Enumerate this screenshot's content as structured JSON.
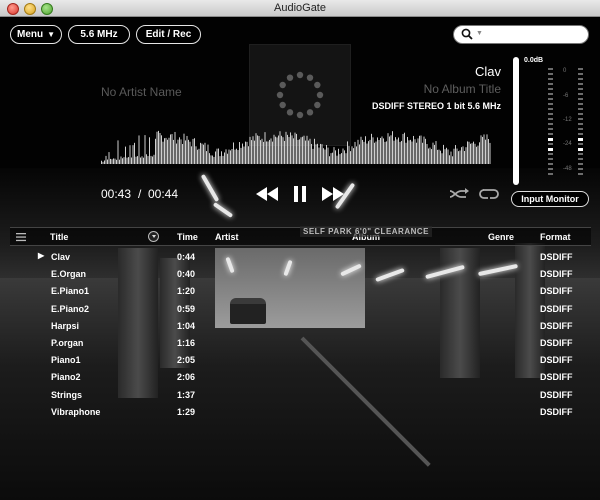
{
  "window": {
    "title": "AudioGate"
  },
  "toolbar": {
    "menu_label": "Menu",
    "frequency_label": "5.6 MHz",
    "edit_label": "Edit / Rec"
  },
  "search": {
    "placeholder": ""
  },
  "now_playing": {
    "artist": "No Artist Name",
    "track": "Clav",
    "album": "No Album Title",
    "format_info": "DSDIFF STEREO 1 bit 5.6 MHz"
  },
  "meter": {
    "peak_label": "0.0dB",
    "ticks": [
      "0",
      "-6",
      "-12",
      "-24",
      "-48"
    ]
  },
  "transport": {
    "current_time": "00:43",
    "separator": "/",
    "total_time": "00:44",
    "input_monitor_label": "Input Monitor"
  },
  "table": {
    "headers": {
      "title": "Title",
      "time": "Time",
      "artist": "Artist",
      "album": "Album",
      "genre": "Genre",
      "format": "Format"
    },
    "rows": [
      {
        "title": "Clav",
        "time": "0:44",
        "format": "DSDIFF",
        "playing": true
      },
      {
        "title": "E.Organ",
        "time": "0:40",
        "format": "DSDIFF",
        "playing": false
      },
      {
        "title": "E.Piano1",
        "time": "1:20",
        "format": "DSDIFF",
        "playing": false
      },
      {
        "title": "E.Piano2",
        "time": "0:59",
        "format": "DSDIFF",
        "playing": false
      },
      {
        "title": "Harpsi",
        "time": "1:04",
        "format": "DSDIFF",
        "playing": false
      },
      {
        "title": "P.organ",
        "time": "1:16",
        "format": "DSDIFF",
        "playing": false
      },
      {
        "title": "Piano1",
        "time": "2:05",
        "format": "DSDIFF",
        "playing": false
      },
      {
        "title": "Piano2",
        "time": "2:06",
        "format": "DSDIFF",
        "playing": false
      },
      {
        "title": "Strings",
        "time": "1:37",
        "format": "DSDIFF",
        "playing": false
      },
      {
        "title": "Vibraphone",
        "time": "1:29",
        "format": "DSDIFF",
        "playing": false
      }
    ]
  },
  "background_sign": "SELF PARK 6'0\" CLEARANCE",
  "colors": {
    "background": "#000000",
    "text": "#ffffff",
    "dim_text": "#5a5a5a"
  }
}
